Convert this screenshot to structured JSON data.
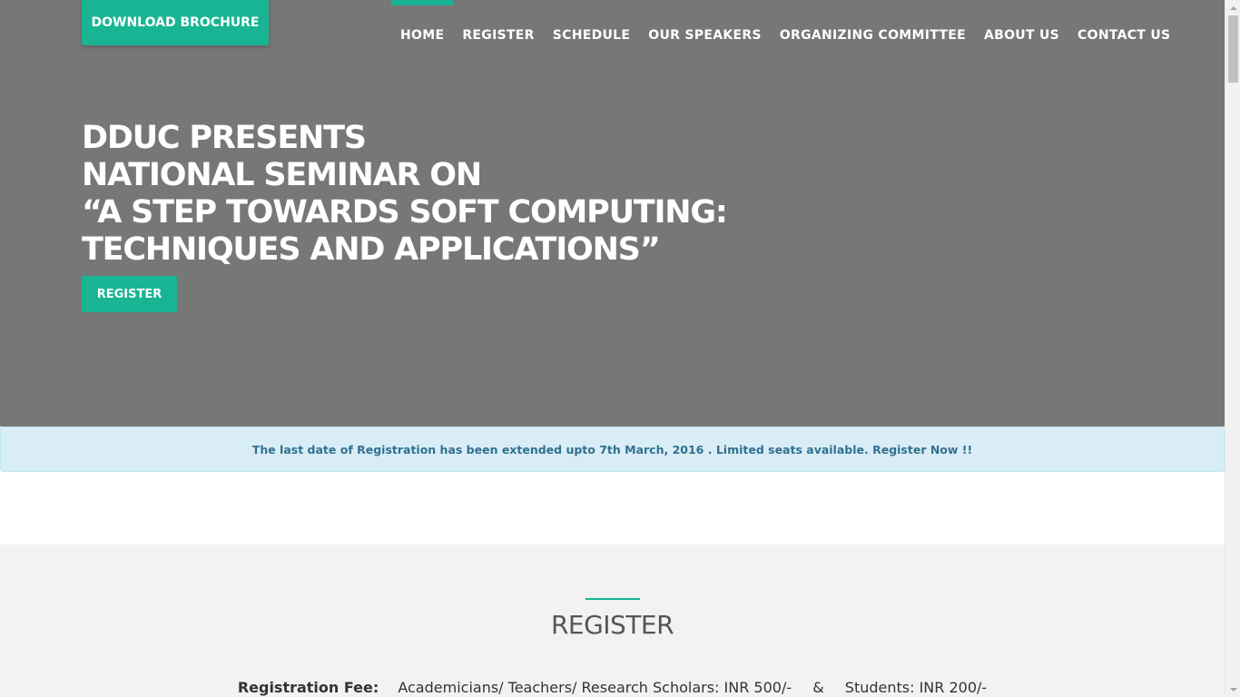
{
  "header": {
    "brochure_label": "DOWNLOAD BROCHURE",
    "nav": [
      "HOME",
      "REGISTER",
      "SCHEDULE",
      "OUR SPEAKERS",
      "ORGANIZING COMMITTEE",
      "ABOUT US",
      "CONTACT US"
    ],
    "active_nav": "HOME"
  },
  "hero": {
    "line1": "DDUC PRESENTS",
    "line2": "NATIONAL SEMINAR ON",
    "line3": "“A STEP TOWARDS SOFT COMPUTING:",
    "line4": "TECHNIQUES AND APPLICATIONS”",
    "register_label": "REGISTER"
  },
  "notice": {
    "text": "The last date of Registration has been extended upto 7th March, 2016 . Limited seats available. Register Now !!"
  },
  "register_section": {
    "title": "REGISTER",
    "fee_label": "Registration Fee:",
    "fee_academic": "Academicians/ Teachers/ Research Scholars:  INR 500/-",
    "fee_sep": "&",
    "fee_students": "Students:  INR 200/-"
  },
  "colors": {
    "accent": "#18b494",
    "hero_bg": "#777777",
    "notice_bg": "#d9edf7",
    "notice_text": "#31708f",
    "section_bg": "#f2f2f2"
  }
}
